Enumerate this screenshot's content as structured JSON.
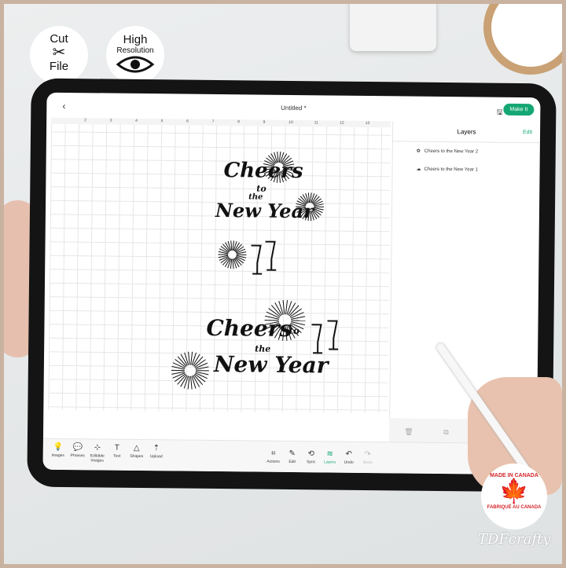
{
  "badges": {
    "cut_file": [
      "Cut",
      "File"
    ],
    "high_res": [
      "High",
      "Resolution"
    ]
  },
  "app": {
    "title": "Untitled *",
    "make_it": "Make It",
    "back": "‹"
  },
  "ruler": [
    "2",
    "3",
    "4",
    "5",
    "6",
    "7",
    "8",
    "9",
    "10",
    "11",
    "12",
    "13"
  ],
  "layers": {
    "title": "Layers",
    "edit": "Edit",
    "items": [
      "Cheers to the New Year 2",
      "Cheers to the New Year 1"
    ]
  },
  "left_tools": [
    "Images",
    "Phrases",
    "Editable Images",
    "Text",
    "Shapes",
    "Upload"
  ],
  "right_tools": [
    "Actions",
    "Edit",
    "Sync",
    "Layers",
    "Undo",
    "Redo"
  ],
  "art": {
    "line1": "Cheers",
    "line2": "to",
    "line3": "the",
    "line4": "New Year"
  },
  "seal": {
    "top": "MADE IN CANADA",
    "bottom": "FABRIQUÉ AU CANADA"
  },
  "brand": "TDFcrafty",
  "colors": {
    "accent": "#14a774",
    "seal": "#d5262b"
  }
}
